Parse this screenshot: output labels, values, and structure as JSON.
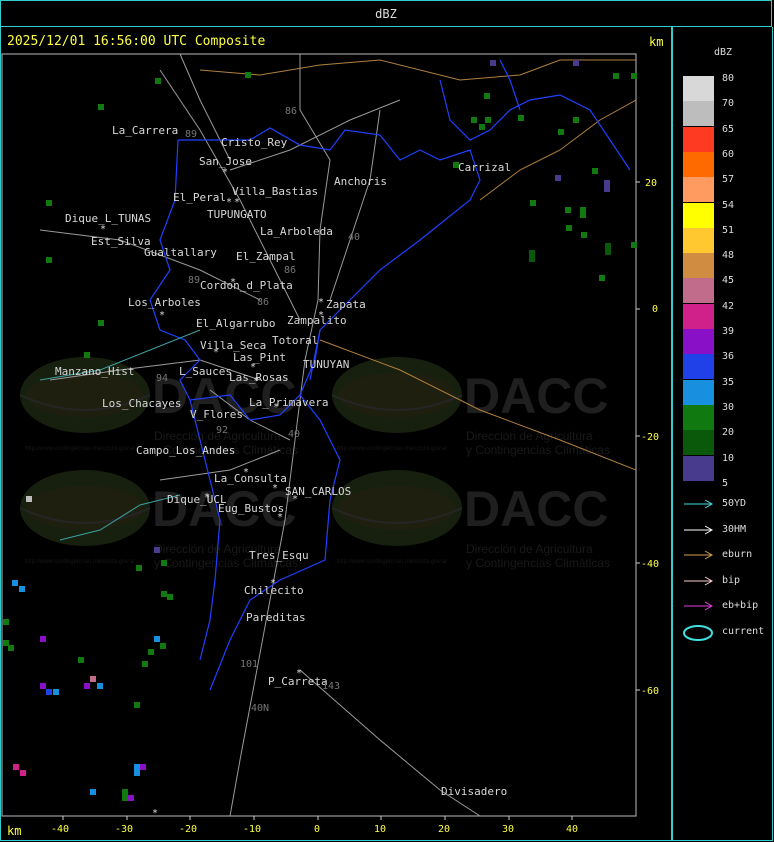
{
  "window_title": "dBZ",
  "header": {
    "title": "2025/12/01 16:56:00 UTC Composite",
    "km_top": "km",
    "km_bottom": "km"
  },
  "x_axis_ticks": [
    "-40",
    "-30",
    "-20",
    "-10",
    "0",
    "10",
    "20",
    "30",
    "40"
  ],
  "y_axis_ticks": [
    "20",
    "0",
    "-20",
    "-40",
    "-60"
  ],
  "legend": {
    "title": "dBZ",
    "scale": [
      {
        "value": "80",
        "color": "#d8d8d8"
      },
      {
        "value": "70",
        "color": "#bdbdbd"
      },
      {
        "value": "65",
        "color": "#ff3a22"
      },
      {
        "value": "60",
        "color": "#ff6a00"
      },
      {
        "value": "57",
        "color": "#ff9a60"
      },
      {
        "value": "54",
        "color": "#ffff00"
      },
      {
        "value": "51",
        "color": "#ffc830"
      },
      {
        "value": "48",
        "color": "#d08c40"
      },
      {
        "value": "45",
        "color": "#c06c8a"
      },
      {
        "value": "42",
        "color": "#d0208a"
      },
      {
        "value": "39",
        "color": "#8a10c8"
      },
      {
        "value": "36",
        "color": "#2040e8"
      },
      {
        "value": "35",
        "color": "#1890e0"
      },
      {
        "value": "30",
        "color": "#107a10"
      },
      {
        "value": "20",
        "color": "#0a580a"
      },
      {
        "value": "10",
        "color": "#483a8c"
      },
      {
        "value": "5",
        "color": "#000000"
      }
    ],
    "tracks": [
      {
        "label": "50YD",
        "color": "#40e0e0"
      },
      {
        "label": "30HM",
        "color": "#ffffff"
      },
      {
        "label": "eburn",
        "color": "#d0a050"
      },
      {
        "label": "bip",
        "color": "#ffd0d0"
      },
      {
        "label": "eb+bip",
        "color": "#e040e0"
      },
      {
        "label": "current",
        "color": "#40e0e0"
      }
    ]
  },
  "places": [
    {
      "name": "La_Carrera"
    },
    {
      "name": "Cristo_Rey"
    },
    {
      "name": "San_Jose"
    },
    {
      "name": "Villa_Bastias"
    },
    {
      "name": "El_Peral"
    },
    {
      "name": "Anchoris"
    },
    {
      "name": "Carrizal"
    },
    {
      "name": "Dique_L_TUNAS"
    },
    {
      "name": "TUPUNGATO"
    },
    {
      "name": "La_Arboleda"
    },
    {
      "name": "Est_Silva"
    },
    {
      "name": "Gualtallary"
    },
    {
      "name": "El_Zampal"
    },
    {
      "name": "Cordon_d_Plata"
    },
    {
      "name": "Los_Arboles"
    },
    {
      "name": "Zapata"
    },
    {
      "name": "El_Algarrubo"
    },
    {
      "name": "Zampalito"
    },
    {
      "name": "Totoral"
    },
    {
      "name": "Villa_Seca"
    },
    {
      "name": "Las_Pint"
    },
    {
      "name": "TUNUYAN"
    },
    {
      "name": "Manzano_Hist"
    },
    {
      "name": "L_Sauces"
    },
    {
      "name": "Las_Rosas"
    },
    {
      "name": "La_Primavera"
    },
    {
      "name": "Los_Chacayes"
    },
    {
      "name": "V_Flores"
    },
    {
      "name": "Campo_Los_Andes"
    },
    {
      "name": "La_Consulta"
    },
    {
      "name": "SAN_CARLOS"
    },
    {
      "name": "Dique_UCL"
    },
    {
      "name": "Eug_Bustos"
    },
    {
      "name": "Tres_Esqu"
    },
    {
      "name": "Chilecito"
    },
    {
      "name": "Pareditas"
    },
    {
      "name": "P_Carreta"
    },
    {
      "name": "Divisadero"
    }
  ],
  "route_labels": [
    "89",
    "86",
    "40",
    "86",
    "86",
    "89",
    "92",
    "94",
    "40",
    "101",
    "143",
    "40N"
  ],
  "watermark": {
    "text": "DACC",
    "line1": "Dirección de Agricultura",
    "line2": "y Contingencias Climáticas",
    "url": "http://www.contingencias.mendoza.gov.ar"
  },
  "echo_levels_dbz": [
    10,
    20,
    30,
    35,
    36,
    39,
    45,
    70
  ]
}
